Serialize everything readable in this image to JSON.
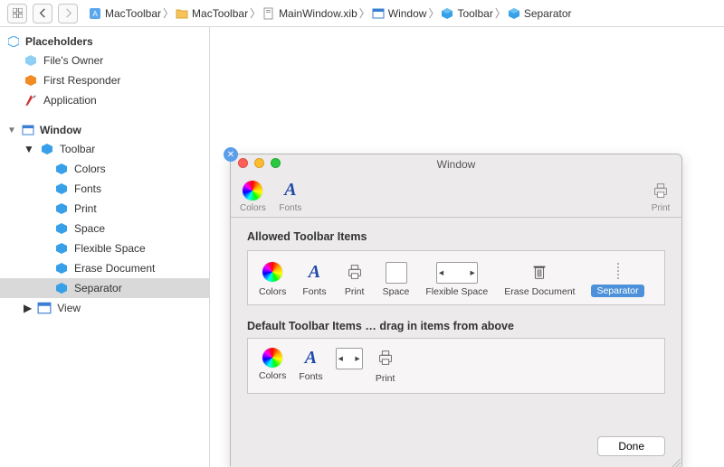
{
  "breadcrumbs": [
    {
      "label": "MacToolbar",
      "icon": "project"
    },
    {
      "label": "MacToolbar",
      "icon": "folder"
    },
    {
      "label": "MainWindow.xib",
      "icon": "file"
    },
    {
      "label": "Window",
      "icon": "window"
    },
    {
      "label": "Toolbar",
      "icon": "cube"
    },
    {
      "label": "Separator",
      "icon": "cube"
    }
  ],
  "placeholders": {
    "title": "Placeholders",
    "items": [
      {
        "label": "File's Owner",
        "icon": "cube-lt"
      },
      {
        "label": "First Responder",
        "icon": "responder"
      },
      {
        "label": "Application",
        "icon": "application"
      }
    ]
  },
  "tree": {
    "window": {
      "label": "Window",
      "children": {
        "toolbar": {
          "label": "Toolbar",
          "children": [
            {
              "label": "Colors"
            },
            {
              "label": "Fonts"
            },
            {
              "label": "Print"
            },
            {
              "label": "Space"
            },
            {
              "label": "Flexible Space"
            },
            {
              "label": "Erase Document"
            },
            {
              "label": "Separator",
              "selected": true
            }
          ]
        },
        "view": {
          "label": "View"
        }
      }
    }
  },
  "window": {
    "title": "Window",
    "toolbar_left": [
      {
        "label": "Colors",
        "icon": "colors"
      },
      {
        "label": "Fonts",
        "icon": "fontA"
      }
    ],
    "toolbar_right": {
      "label": "Print",
      "icon": "printer"
    },
    "allowed_title": "Allowed Toolbar Items",
    "allowed": [
      {
        "label": "Colors",
        "icon": "colors"
      },
      {
        "label": "Fonts",
        "icon": "fontA"
      },
      {
        "label": "Print",
        "icon": "printer"
      },
      {
        "label": "Space",
        "icon": "box"
      },
      {
        "label": "Flexible Space",
        "icon": "flexbox"
      },
      {
        "label": "Erase Document",
        "icon": "trash"
      },
      {
        "label": "Separator",
        "icon": "separator",
        "selected": true
      }
    ],
    "default_title": "Default Toolbar Items … drag in items from above",
    "defaults": [
      {
        "label": "Colors",
        "icon": "colors"
      },
      {
        "label": "Fonts",
        "icon": "fontA"
      },
      {
        "label": "",
        "icon": "flexbox"
      },
      {
        "label": "Print",
        "icon": "printer"
      }
    ],
    "done": "Done"
  }
}
